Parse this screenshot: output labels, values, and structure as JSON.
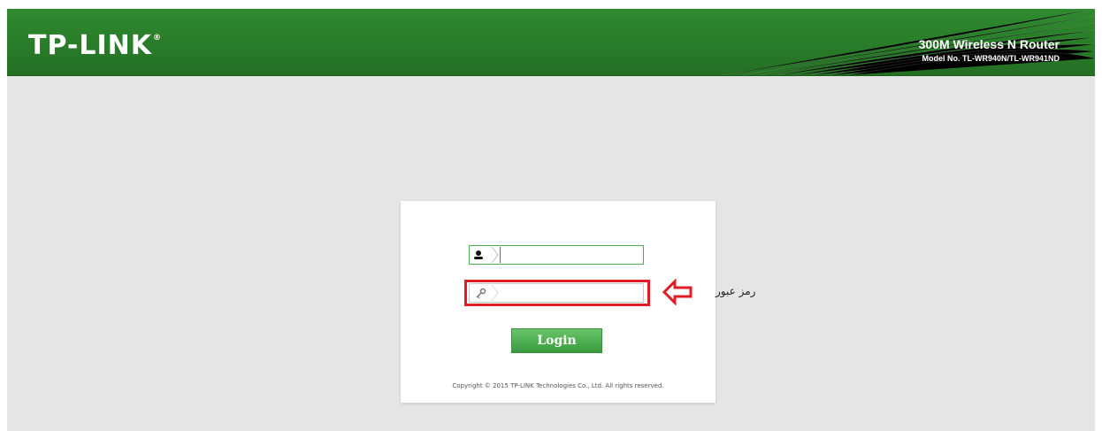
{
  "header": {
    "logo_text": "TP-LINK",
    "logo_mark": "®",
    "product_title": "300M Wireless N Router",
    "model_text": "Model No. TL-WR940N/TL-WR941ND"
  },
  "login": {
    "username_value": "",
    "password_value": "",
    "button_label": "Login",
    "copyright": "Copyright © 2015 TP-LINK Technologies Co., Ltd. All rights reserved.",
    "icons": {
      "username": "user-icon",
      "password": "key-icon",
      "highlight_arrow": "arrow-left-icon"
    }
  },
  "annotation": {
    "label": "رمز عبور"
  },
  "colors": {
    "brand_green": "#2a7f2a",
    "button_green": "#4caf50",
    "highlight_red": "#e01c24"
  }
}
